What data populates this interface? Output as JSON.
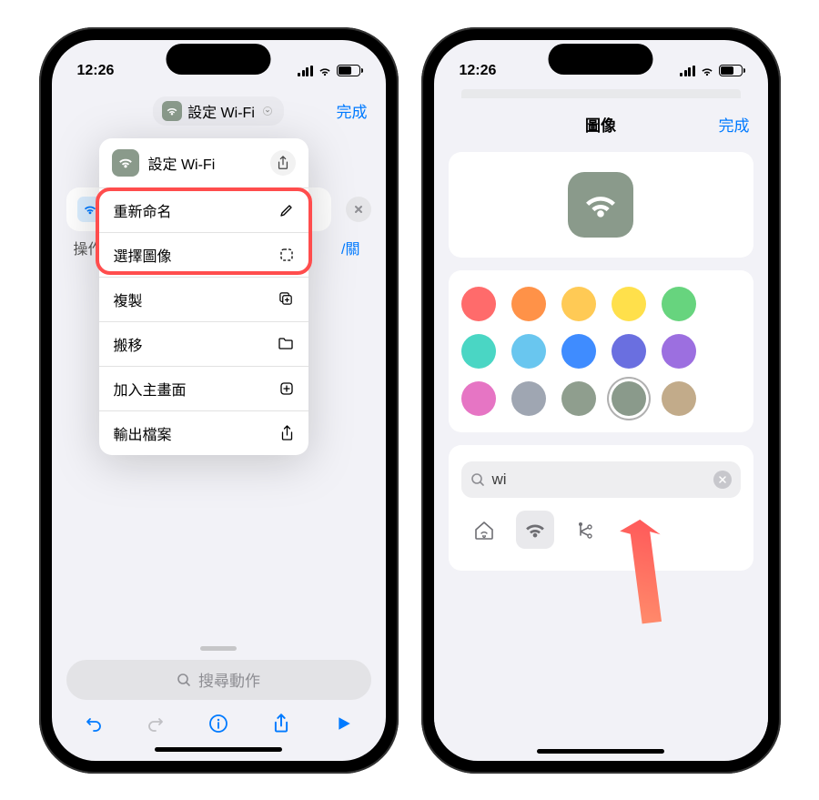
{
  "status_bar": {
    "time": "12:26"
  },
  "left": {
    "header": {
      "title": "設定 Wi-Fi",
      "done": "完成"
    },
    "popover": {
      "title": "設定 Wi-Fi",
      "menu": {
        "rename": "重新命名",
        "choose_image": "選擇圖像",
        "duplicate": "複製",
        "move": "搬移",
        "add_to_home": "加入主畫面",
        "export_file": "輸出檔案"
      }
    },
    "obscured": {
      "action_label": "操作",
      "toggle_tail": "/關"
    },
    "search_placeholder": "搜尋動作"
  },
  "right": {
    "title": "圖像",
    "done": "完成",
    "colors": [
      "#ff6b6b",
      "#ff9248",
      "#ffca55",
      "#ffe04b",
      "#67d47e",
      "#4ad6c4",
      "#69c6ef",
      "#3f8cff",
      "#6a6fe0",
      "#9c6fe0",
      "#e675c4",
      "#9fa6b2",
      "#8f9e8e",
      "#8a9a8b",
      "#c2ab8a"
    ],
    "selected_color_index": 13,
    "search": {
      "value": "wi"
    },
    "glyphs": [
      "home-wifi-icon",
      "wifi-icon",
      "satellite-icon"
    ],
    "selected_glyph_index": 1
  }
}
